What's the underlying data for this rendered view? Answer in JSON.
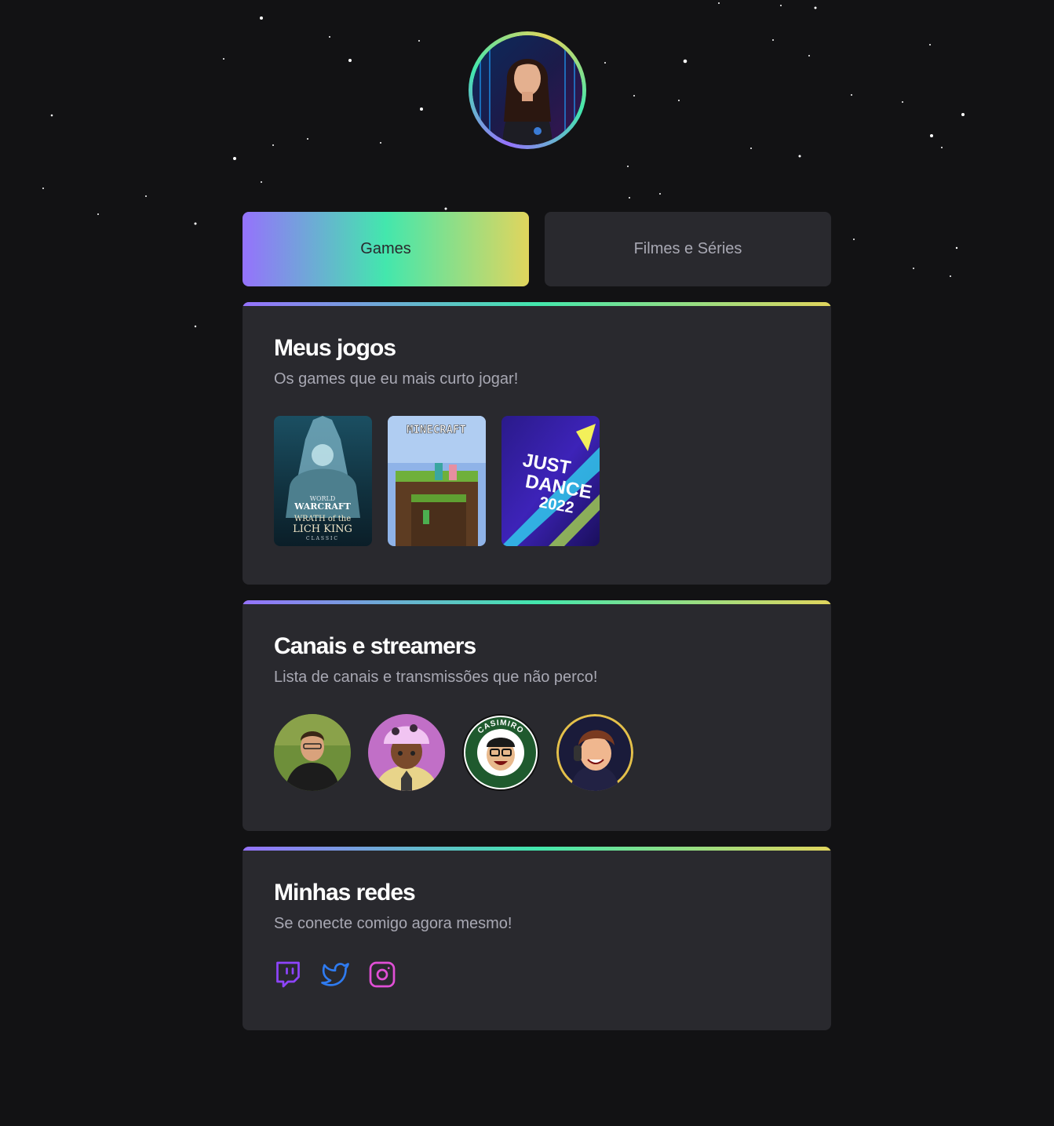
{
  "profile": {
    "avatar_icon": "profile-avatar"
  },
  "tabs": [
    {
      "label": "Games",
      "active": true
    },
    {
      "label": "Filmes e Séries",
      "active": false
    }
  ],
  "sections": {
    "games": {
      "title": "Meus jogos",
      "subtitle": "Os games que eu mais curto jogar!",
      "items": [
        {
          "logo_lines": [
            "WORLD",
            "WARCRAFT",
            "WRATH of the",
            "LICH KING",
            "CLASSIC"
          ]
        },
        {
          "logo": "MINECRAFT"
        },
        {
          "logo_lines": [
            "JUST",
            "DANCE",
            "2022"
          ]
        }
      ]
    },
    "streamers": {
      "title": "Canais e streamers",
      "subtitle": "Lista de canais e transmissões que não perco!",
      "items": [
        {
          "icon": "streamer-photo"
        },
        {
          "icon": "streamer-cartoon"
        },
        {
          "badge_text": "CASIMIRO"
        },
        {
          "icon": "streamer-cartoon-headset"
        }
      ]
    },
    "socials": {
      "title": "Minhas redes",
      "subtitle": "Se conecte comigo agora mesmo!",
      "items": [
        {
          "icon": "twitch-icon",
          "color": "#8e44ff"
        },
        {
          "icon": "twitter-icon",
          "color": "#2f7bf0"
        },
        {
          "icon": "instagram-icon",
          "color": "#e04fd6"
        }
      ]
    }
  },
  "colors": {
    "background": "#121214",
    "card": "#29292e",
    "gradient": [
      "#9572fc",
      "#43e7ad",
      "#e1d55d"
    ],
    "subtitle": "#a8a8b3"
  }
}
